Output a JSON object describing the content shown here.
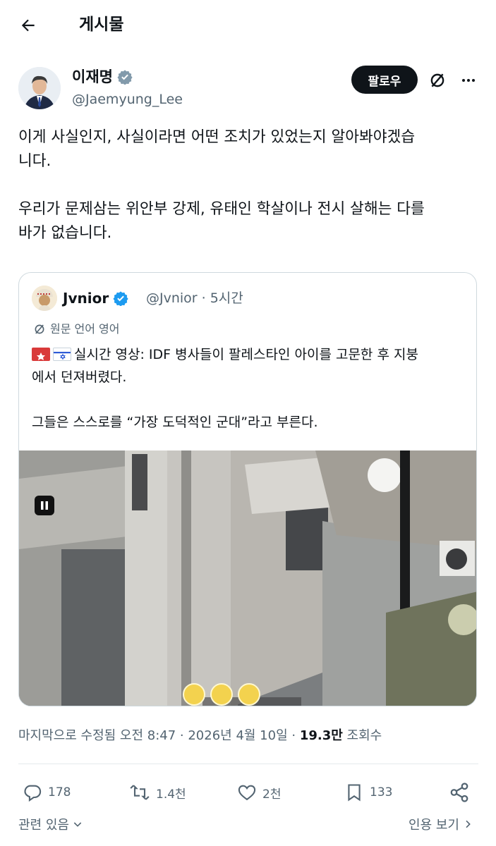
{
  "header": {
    "title": "게시물"
  },
  "author": {
    "name": "이재명",
    "handle": "@Jaemyung_Lee"
  },
  "follow_label": "팔로우",
  "post": {
    "line1": "이게 사실인지, 사실이라면 어떤 조치가 있었는지 알아봐야겠습",
    "line2": "니다.",
    "line3": "우리가 문제삼는 위안부 강제, 유태인 학살이나 전시 살해는 다를",
    "line4": "바가 없습니다."
  },
  "quote": {
    "name": "Jvnior",
    "meta": "@Jvnior · 5시간",
    "translate_label": "원문 언어 영어",
    "line1": "실시간 영상: IDF 병사들이 팔레스타인 아이를 고문한 후 지붕",
    "line2": "에서 던져버렸다.",
    "line3": "그들은 스스로를 “가장 도덕적인 군대”라고 부른다."
  },
  "meta": {
    "prefix": "마지막으로 수정됨 오전 8:47 · 2026년 4월 10일 · ",
    "views": "19.3만",
    "views_label": " 조회수"
  },
  "actions": {
    "replies": "178",
    "reposts": "1.4천",
    "likes": "2천",
    "bookmarks": "133"
  },
  "footer": {
    "related": "관련 있음",
    "quotes": "인용 보기"
  },
  "icons": {
    "back": "back-arrow-icon",
    "verified": "verified-badge-icon",
    "grok": "grok-icon",
    "more": "more-icon",
    "reply": "reply-icon",
    "repost": "repost-icon",
    "like": "heart-icon",
    "bookmark": "bookmark-icon",
    "share": "share-icon"
  },
  "colors": {
    "verified": "#1d9bf0",
    "text": "#0f1419",
    "muted": "#536471",
    "follow_bg": "#0f1419"
  }
}
